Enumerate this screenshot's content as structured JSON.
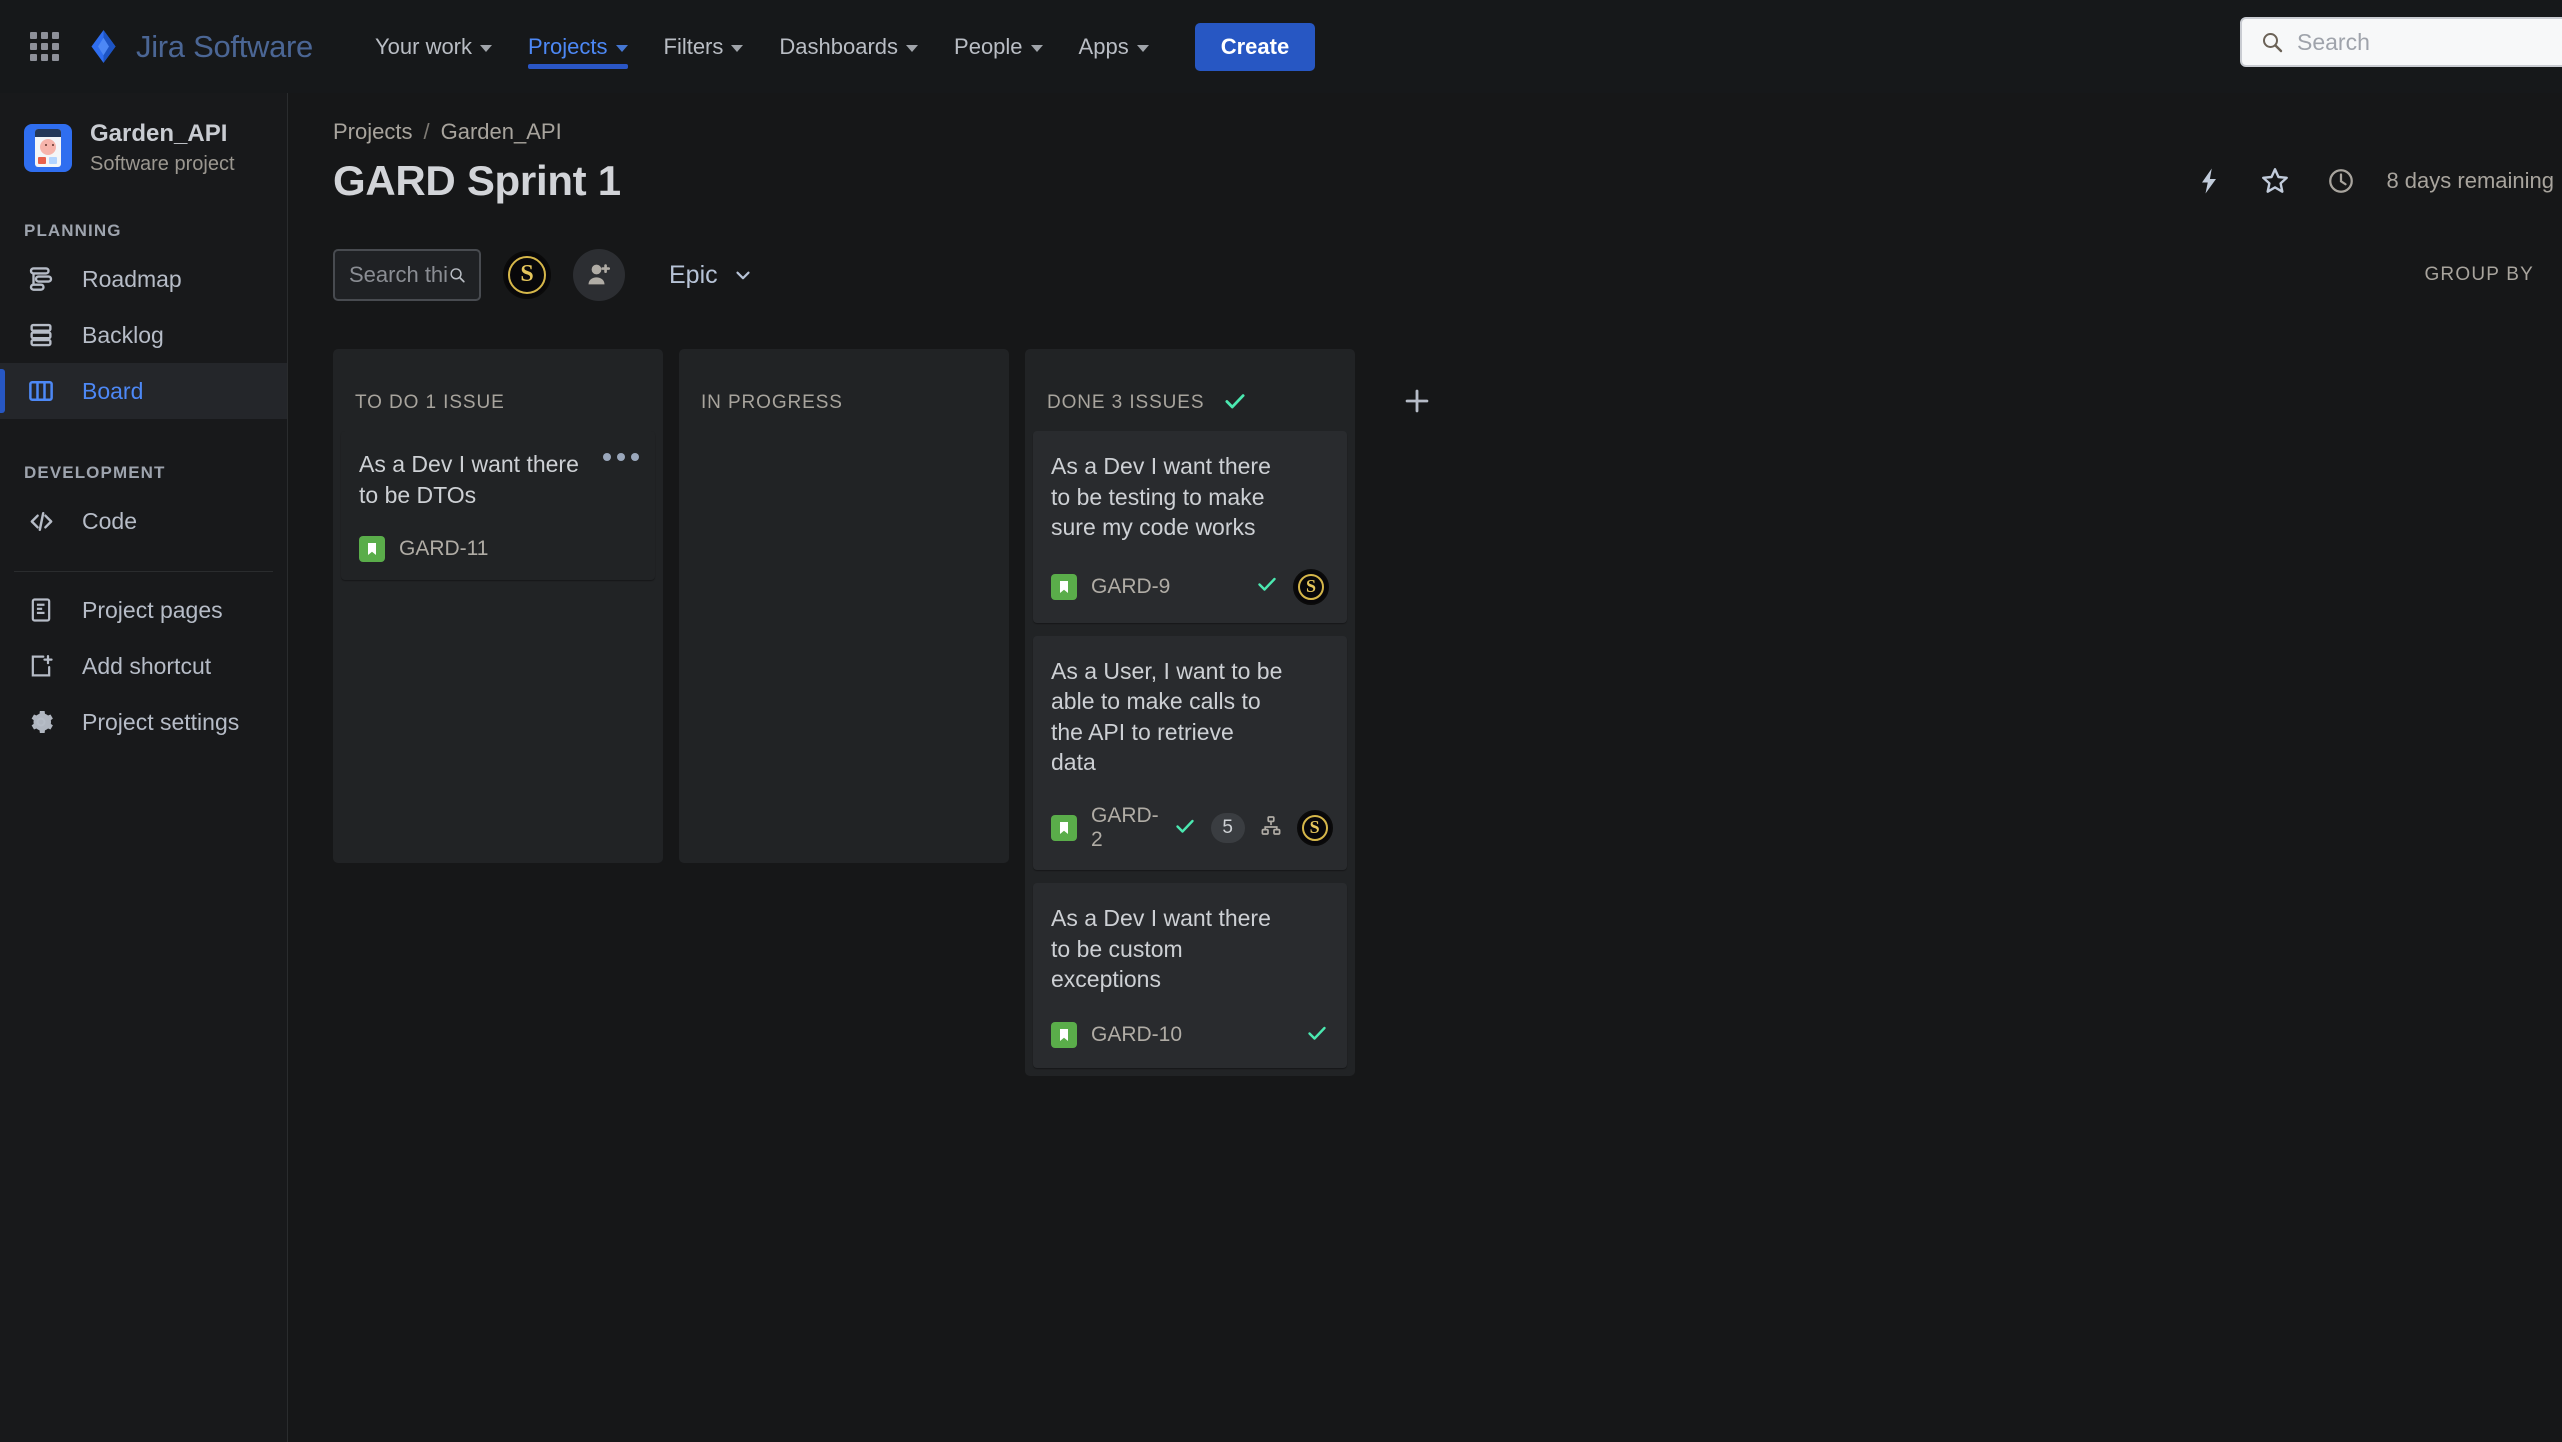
{
  "topnav": {
    "app_switcher_icon": "grid-apps-icon",
    "brand": "Jira Software",
    "items": [
      {
        "label": "Your work",
        "has_chevron": true,
        "active": false
      },
      {
        "label": "Projects",
        "has_chevron": true,
        "active": true
      },
      {
        "label": "Filters",
        "has_chevron": true,
        "active": false
      },
      {
        "label": "Dashboards",
        "has_chevron": true,
        "active": false
      },
      {
        "label": "People",
        "has_chevron": true,
        "active": false
      },
      {
        "label": "Apps",
        "has_chevron": true,
        "active": false
      }
    ],
    "create_label": "Create",
    "search_placeholder": "Search",
    "search_value": ""
  },
  "sidebar": {
    "project_name": "Garden_API",
    "project_type": "Software project",
    "sections": [
      {
        "label": "PLANNING"
      },
      {
        "label": "DEVELOPMENT"
      }
    ],
    "planning_items": [
      {
        "label": "Roadmap",
        "icon": "roadmap-icon",
        "selected": false
      },
      {
        "label": "Backlog",
        "icon": "backlog-icon",
        "selected": false
      },
      {
        "label": "Board",
        "icon": "board-icon",
        "selected": true
      }
    ],
    "development_items": [
      {
        "label": "Code",
        "icon": "code-icon",
        "selected": false
      }
    ],
    "footer_items": [
      {
        "label": "Project pages",
        "icon": "pages-icon"
      },
      {
        "label": "Add shortcut",
        "icon": "add-shortcut-icon"
      },
      {
        "label": "Project settings",
        "icon": "gear-icon"
      }
    ]
  },
  "header": {
    "breadcrumb": {
      "root": "Projects",
      "separator": "/",
      "project": "Garden_API"
    },
    "title": "GARD Sprint 1",
    "actions": [
      {
        "icon": "lightning-icon"
      },
      {
        "icon": "star-icon"
      }
    ],
    "sprint_status_icon": "clock-icon",
    "sprint_status": "8 days remaining"
  },
  "toolbar": {
    "search_placeholder": "Search this b",
    "search_value": "",
    "search_icon": "search-icon",
    "avatar_initial": "S",
    "add_person_icon": "add-person-icon",
    "epic_label": "Epic",
    "group_by_label": "GROUP BY"
  },
  "colors": {
    "accent_blue": "#4d88f5",
    "create_blue": "#2757c3",
    "done_green": "#4be8b0",
    "story_green": "#5aad4a",
    "avatar_gold": "#e6c65c"
  },
  "board": {
    "add_column_icon": "plus-icon",
    "columns": [
      {
        "title": "TO DO 1 ISSUE",
        "has_check": false,
        "cards": [
          {
            "title": "As a Dev I want there to be DTOs",
            "key": "GARD-11",
            "type_icon": "story-icon",
            "has_menu": true,
            "has_check": false,
            "points": null,
            "has_subtask_icon": false,
            "avatar": null
          }
        ]
      },
      {
        "title": "IN PROGRESS",
        "has_check": false,
        "cards": []
      },
      {
        "title": "DONE 3 ISSUES",
        "has_check": true,
        "cards": [
          {
            "title": "As a Dev I want there to be testing to make sure my code works",
            "key": "GARD-9",
            "type_icon": "story-icon",
            "has_menu": false,
            "has_check": true,
            "points": null,
            "has_subtask_icon": false,
            "avatar": "S"
          },
          {
            "title": "As a User, I want to be able to make calls to the API to retrieve data",
            "key": "GARD-2",
            "type_icon": "story-icon",
            "has_menu": false,
            "has_check": true,
            "points": "5",
            "has_subtask_icon": true,
            "avatar": "S"
          },
          {
            "title": "As a Dev I want there to be custom exceptions",
            "key": "GARD-10",
            "type_icon": "story-icon",
            "has_menu": false,
            "has_check": true,
            "points": null,
            "has_subtask_icon": false,
            "avatar": null
          }
        ]
      }
    ]
  }
}
